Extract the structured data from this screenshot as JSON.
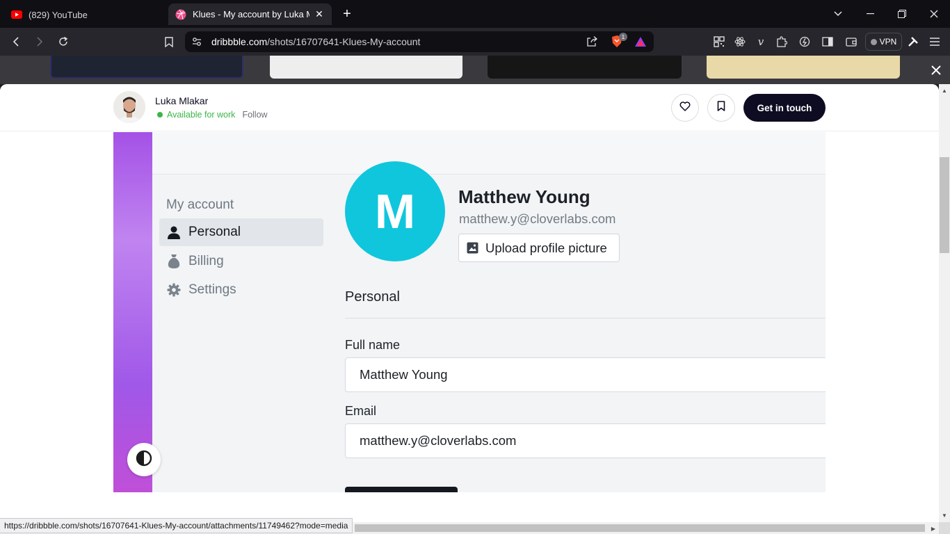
{
  "browser": {
    "tabs": [
      {
        "title": "(829) YouTube",
        "favicon": "youtube-icon"
      },
      {
        "title": "Klues - My account by Luka Mlakar",
        "favicon": "dribbble-icon"
      }
    ],
    "url_host": "dribbble.com",
    "url_path": "/shots/16707641-Klues-My-account",
    "vpn_label": "VPN",
    "status_url": "https://dribbble.com/shots/16707641-Klues-My-account/attachments/11749462?mode=media",
    "shield_count": "1"
  },
  "shot_header": {
    "author": "Luka Mlakar",
    "availability": "Available for work",
    "follow": "Follow",
    "cta": "Get in touch"
  },
  "design": {
    "sidebar": {
      "title": "My account",
      "items": [
        {
          "label": "Personal",
          "icon": "person-icon",
          "active": true
        },
        {
          "label": "Billing",
          "icon": "money-bag-icon",
          "active": false
        },
        {
          "label": "Settings",
          "icon": "gear-icon",
          "active": false
        }
      ]
    },
    "profile": {
      "initial": "M",
      "name": "Matthew Young",
      "email": "matthew.y@cloverlabs.com",
      "upload_label": "Upload profile picture"
    },
    "section_title": "Personal",
    "fields": [
      {
        "label": "Full name",
        "value": "Matthew Young"
      },
      {
        "label": "Email",
        "value": "matthew.y@cloverlabs.com"
      }
    ]
  },
  "colors": {
    "accent_dark": "#0d0c22",
    "available_green": "#3bb54a",
    "avatar_cyan": "#10c6dc",
    "purple_strip": "#a452e6"
  }
}
